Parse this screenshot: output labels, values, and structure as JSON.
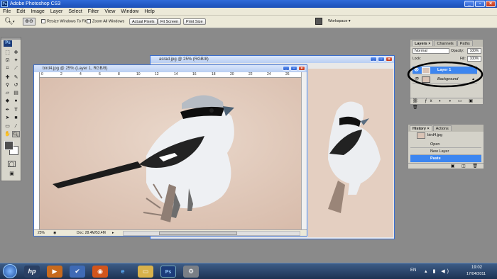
{
  "window": {
    "title": "Adobe Photoshop CS3",
    "app_icon": "Ps"
  },
  "menu": [
    "File",
    "Edit",
    "Image",
    "Layer",
    "Select",
    "Filter",
    "View",
    "Window",
    "Help"
  ],
  "options": {
    "resize_windows": "Resize Windows To Fit",
    "zoom_all": "Zoom All Windows",
    "actual_pixels": "Actual Pixels",
    "fit_screen": "Fit Screen",
    "print_size": "Print Size",
    "workspace": "Workspace ▾"
  },
  "doc_back": {
    "title": "asrad.jpg @ 25% (RGB/8)"
  },
  "doc_front": {
    "title": "bird4.jpg @ 25% (Layer 1, RGB/8)",
    "ruler": [
      "0",
      "2",
      "4",
      "6",
      "8",
      "10",
      "12",
      "14",
      "16",
      "18",
      "20",
      "22",
      "24",
      "26"
    ],
    "zoom": "25%",
    "status": "Doc: 28.4M/53.4M"
  },
  "layers_panel": {
    "tabs": [
      "Layers ×",
      "Channels",
      "Paths"
    ],
    "mode": "Normal",
    "opacity_label": "Opacity:",
    "opacity": "100%",
    "lock_label": "Lock:",
    "fill_label": "Fill:",
    "fill": "100%",
    "layers": [
      "Layer 1",
      "Background"
    ]
  },
  "history_panel": {
    "tabs": [
      "History ×",
      "Actions"
    ],
    "snapshot": "bird4.jpg",
    "items": [
      "Open",
      "New Layer",
      "Paste"
    ]
  },
  "taskbar": {
    "lang": "EN",
    "time": "19:02",
    "date": "17/04/2011"
  },
  "colors": {
    "accent": "#3d7de8",
    "selected": "#3d86f0"
  }
}
